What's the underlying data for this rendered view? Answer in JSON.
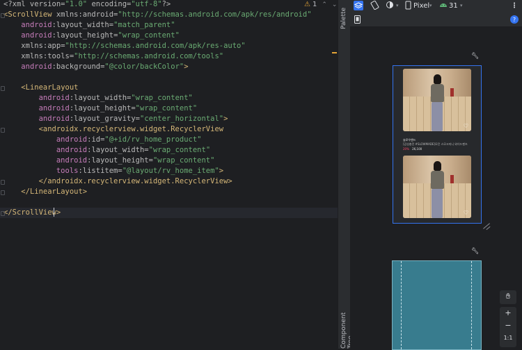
{
  "editor": {
    "lines": [
      [
        {
          "c": "t-pi",
          "t": "<?xml version="
        },
        {
          "c": "t-str",
          "t": "\"1.0\""
        },
        {
          "c": "t-pi",
          "t": " encoding="
        },
        {
          "c": "t-str",
          "t": "\"utf-8\""
        },
        {
          "c": "t-pi",
          "t": "?>"
        }
      ],
      [
        {
          "c": "t-tag",
          "t": "<ScrollView "
        },
        {
          "c": "t-attr",
          "t": "xmlns:android="
        },
        {
          "c": "t-str",
          "t": "\"http://schemas.android.com/apk/res/android\""
        }
      ],
      [
        {
          "c": "t-plain",
          "t": "    "
        },
        {
          "c": "t-ns",
          "t": "android"
        },
        {
          "c": "t-attr",
          "t": ":layout_width="
        },
        {
          "c": "t-str",
          "t": "\"match_parent\""
        }
      ],
      [
        {
          "c": "t-plain",
          "t": "    "
        },
        {
          "c": "t-ns",
          "t": "android"
        },
        {
          "c": "t-attr",
          "t": ":layout_height="
        },
        {
          "c": "t-str",
          "t": "\"wrap_content\""
        }
      ],
      [
        {
          "c": "t-plain",
          "t": "    "
        },
        {
          "c": "t-attr",
          "t": "xmlns:app="
        },
        {
          "c": "t-str",
          "t": "\"http://schemas.android.com/apk/res-auto\""
        }
      ],
      [
        {
          "c": "t-plain",
          "t": "    "
        },
        {
          "c": "t-attr",
          "t": "xmlns:tools="
        },
        {
          "c": "t-str",
          "t": "\"http://schemas.android.com/tools\""
        }
      ],
      [
        {
          "c": "t-plain",
          "t": "    "
        },
        {
          "c": "t-ns",
          "t": "android"
        },
        {
          "c": "t-attr",
          "t": ":background="
        },
        {
          "c": "t-str",
          "t": "\"@color/backColor\""
        },
        {
          "c": "t-tag",
          "t": ">"
        }
      ],
      [
        {
          "c": "t-plain",
          "t": ""
        }
      ],
      [
        {
          "c": "t-plain",
          "t": "    "
        },
        {
          "c": "t-tag",
          "t": "<LinearLayout"
        }
      ],
      [
        {
          "c": "t-plain",
          "t": "        "
        },
        {
          "c": "t-ns",
          "t": "android"
        },
        {
          "c": "t-attr",
          "t": ":layout_width="
        },
        {
          "c": "t-str",
          "t": "\"wrap_content\""
        }
      ],
      [
        {
          "c": "t-plain",
          "t": "        "
        },
        {
          "c": "t-ns",
          "t": "android"
        },
        {
          "c": "t-attr",
          "t": ":layout_height="
        },
        {
          "c": "t-str",
          "t": "\"wrap_content\""
        }
      ],
      [
        {
          "c": "t-plain",
          "t": "        "
        },
        {
          "c": "t-ns",
          "t": "android"
        },
        {
          "c": "t-attr",
          "t": ":layout_gravity="
        },
        {
          "c": "t-str",
          "t": "\"center_horizontal\""
        },
        {
          "c": "t-tag",
          "t": ">"
        }
      ],
      [
        {
          "c": "t-plain",
          "t": "        "
        },
        {
          "c": "t-tag",
          "t": "<androidx.recyclerview.widget.RecyclerView"
        }
      ],
      [
        {
          "c": "t-plain",
          "t": "            "
        },
        {
          "c": "t-ns",
          "t": "android"
        },
        {
          "c": "t-attr",
          "t": ":id="
        },
        {
          "c": "t-str",
          "t": "\"@+id/rv_home_product\""
        }
      ],
      [
        {
          "c": "t-plain",
          "t": "            "
        },
        {
          "c": "t-ns",
          "t": "android"
        },
        {
          "c": "t-attr",
          "t": ":layout_width="
        },
        {
          "c": "t-str",
          "t": "\"wrap_content\""
        }
      ],
      [
        {
          "c": "t-plain",
          "t": "            "
        },
        {
          "c": "t-ns",
          "t": "android"
        },
        {
          "c": "t-attr",
          "t": ":layout_height="
        },
        {
          "c": "t-str",
          "t": "\"wrap_content\""
        }
      ],
      [
        {
          "c": "t-plain",
          "t": "            "
        },
        {
          "c": "t-ns",
          "t": "tools"
        },
        {
          "c": "t-attr",
          "t": ":listitem="
        },
        {
          "c": "t-str",
          "t": "\"@layout/rv_home_item\""
        },
        {
          "c": "t-tag",
          "t": ">"
        }
      ],
      [
        {
          "c": "t-plain",
          "t": "        "
        },
        {
          "c": "t-tag",
          "t": "</androidx.recyclerview.widget.RecyclerView>"
        }
      ],
      [
        {
          "c": "t-plain",
          "t": "    "
        },
        {
          "c": "t-tag",
          "t": "</LinearLayout>"
        }
      ],
      [
        {
          "c": "t-plain",
          "t": ""
        }
      ],
      [
        {
          "c": "t-tag",
          "t": "</ScrollView>"
        }
      ]
    ],
    "warning_count": "1"
  },
  "side_tabs": {
    "palette": "Palette",
    "component_tree": "Component Tree"
  },
  "toolbar": {
    "device": "Pixel",
    "api_level": "31"
  },
  "preview": {
    "cards": [
      {
        "brand": "슬로우앤드",
        "title": "[감성충전 #SLOWMADE]모던 스모크미니 와이드팬츠",
        "discount": "20%",
        "price": "26,100"
      }
    ]
  },
  "zoom": {
    "zoom_in": "+",
    "zoom_out": "−",
    "reset": "1:1"
  },
  "colors": {
    "selection": "#3574f0",
    "blueprint": "#387c8e",
    "warning": "#e6a537"
  }
}
